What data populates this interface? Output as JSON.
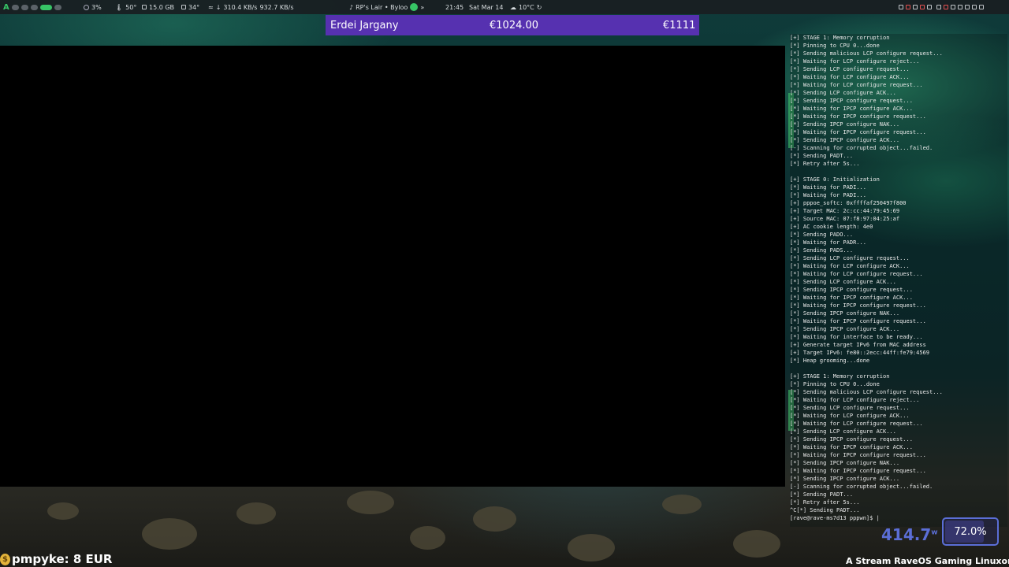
{
  "topbar": {
    "cpu": "3%",
    "cpu_temp": "50°",
    "ram": "15.0 GB",
    "gpu_temp": "34°",
    "net_down": "310.4 KB/s",
    "net_up": "932.7 KB/s",
    "music": "RP's Lair • Byloo",
    "time": "21:45",
    "date": "Sat Mar 14",
    "weather": "10°C"
  },
  "banner": {
    "name": "Erdei Jargany",
    "amount": "€1024.00",
    "goal": "€1111"
  },
  "terminal": {
    "lines": [
      "[+] STAGE 1: Memory corruption",
      "[*] Pinning to CPU 0...done",
      "[*] Sending malicious LCP configure request...",
      "[*] Waiting for LCP configure reject...",
      "[*] Sending LCP configure request...",
      "[*] Waiting for LCP configure ACK...",
      "[*] Waiting for LCP configure request...",
      "[*] Sending LCP configure ACK...",
      "[*] Sending IPCP configure request...",
      "[*] Waiting for IPCP configure ACK...",
      "[*] Waiting for IPCP configure request...",
      "[*] Sending IPCP configure NAK...",
      "[*] Waiting for IPCP configure request...",
      "[*] Sending IPCP configure ACK...",
      "[-] Scanning for corrupted object...failed.",
      "[*] Sending PADT...",
      "[*] Retry after 5s...",
      "",
      "[+] STAGE 0: Initialization",
      "[*] Waiting for PADI...",
      "[*] Waiting for PADI...",
      "[+] pppoe_softc: 0xffffaf250497f800",
      "[+] Target MAC: 2c:cc:44:79:45:69",
      "[+] Source MAC: 07:f8:97:04:25:af",
      "[+] AC cookie length: 4e0",
      "[*] Sending PADO...",
      "[*] Waiting for PADR...",
      "[*] Sending PADS...",
      "[*] Sending LCP configure request...",
      "[*] Waiting for LCP configure ACK...",
      "[*] Waiting for LCP configure request...",
      "[*] Sending LCP configure ACK...",
      "[*] Sending IPCP configure request...",
      "[*] Waiting for IPCP configure ACK...",
      "[*] Waiting for IPCP configure request...",
      "[*] Sending IPCP configure NAK...",
      "[*] Waiting for IPCP configure request...",
      "[*] Sending IPCP configure ACK...",
      "[*] Waiting for interface to be ready...",
      "[+] Generate target IPv6 from MAC address",
      "[+] Target IPv6: fe80::2ecc:44ff:fe79:4569",
      "[*] Heap grooming...done",
      "",
      "[+] STAGE 1: Memory corruption",
      "[*] Pinning to CPU 0...done",
      "[*] Sending malicious LCP configure request...",
      "[*] Waiting for LCP configure reject...",
      "[*] Sending LCP configure request...",
      "[*] Waiting for LCP configure ACK...",
      "[*] Waiting for LCP configure request...",
      "[*] Sending LCP configure ACK...",
      "[*] Sending IPCP configure request...",
      "[*] Waiting for IPCP configure ACK...",
      "[*] Waiting for IPCP configure request...",
      "[*] Sending IPCP configure NAK...",
      "[*] Waiting for IPCP configure request...",
      "[*] Sending IPCP configure ACK...",
      "[-] Scanning for corrupted object...failed.",
      "[*] Sending PADT...",
      "[*] Retry after 5s...",
      "^C[*] Sending PADT...",
      "[rave@rave-ms7d13 pppwn]$ |"
    ]
  },
  "power": {
    "value": "414.7",
    "unit": "w"
  },
  "battery": {
    "percent": "72.0%"
  },
  "alert": {
    "text": "pmpyke: 8 EUR"
  },
  "ticker": {
    "text": "A Stream RaveOS Gaming Linuxon fut"
  },
  "colors": {
    "accent_green": "#37c466",
    "banner_purple": "#5631b0",
    "power_blue": "#5b6ed6"
  }
}
